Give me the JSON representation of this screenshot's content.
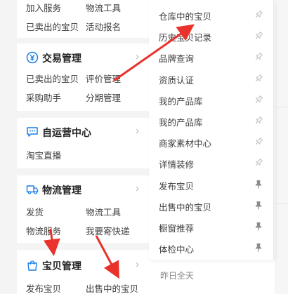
{
  "sidebar": {
    "top_links": [
      [
        "加入服务",
        "物流工具"
      ],
      [
        "已卖出的宝贝",
        "活动报名"
      ]
    ],
    "trade": {
      "title": "交易管理",
      "icon": "yen-circle-icon",
      "links": [
        [
          "已卖出的宝贝",
          "评价管理"
        ],
        [
          "采购助手",
          "分期管理"
        ]
      ]
    },
    "self_run": {
      "title": "自运营中心",
      "icon": "chat-bubble-icon",
      "links": [
        [
          "淘宝直播"
        ]
      ]
    },
    "logistics": {
      "title": "物流管理",
      "icon": "truck-icon",
      "links": [
        [
          "发货",
          "物流工具"
        ],
        [
          "物流服务",
          "我要寄快递"
        ]
      ]
    },
    "goods": {
      "title": "宝贝管理",
      "icon": "shopping-bag-icon",
      "links": [
        [
          "发布宝贝",
          "出售中的宝贝"
        ]
      ]
    },
    "chevron": "›"
  },
  "menu": {
    "items": [
      "仓库中的宝贝",
      "历史宝贝记录",
      "品牌查询",
      "资质认证",
      "我的产品库",
      "我的产品库",
      "商家素材中心",
      "详情装修",
      "发布宝贝",
      "出售中的宝贝",
      "橱窗推荐",
      "体检中心"
    ],
    "pinned_indices": [
      8,
      9,
      10,
      11
    ],
    "pin_icon": "pushpin-icon"
  },
  "background": {
    "yesterday_label": "昨日全天"
  },
  "colors": {
    "accent": "#1a7fe6",
    "annotation": "#e8322b",
    "sidebar_bg": "#f4f4f4"
  }
}
